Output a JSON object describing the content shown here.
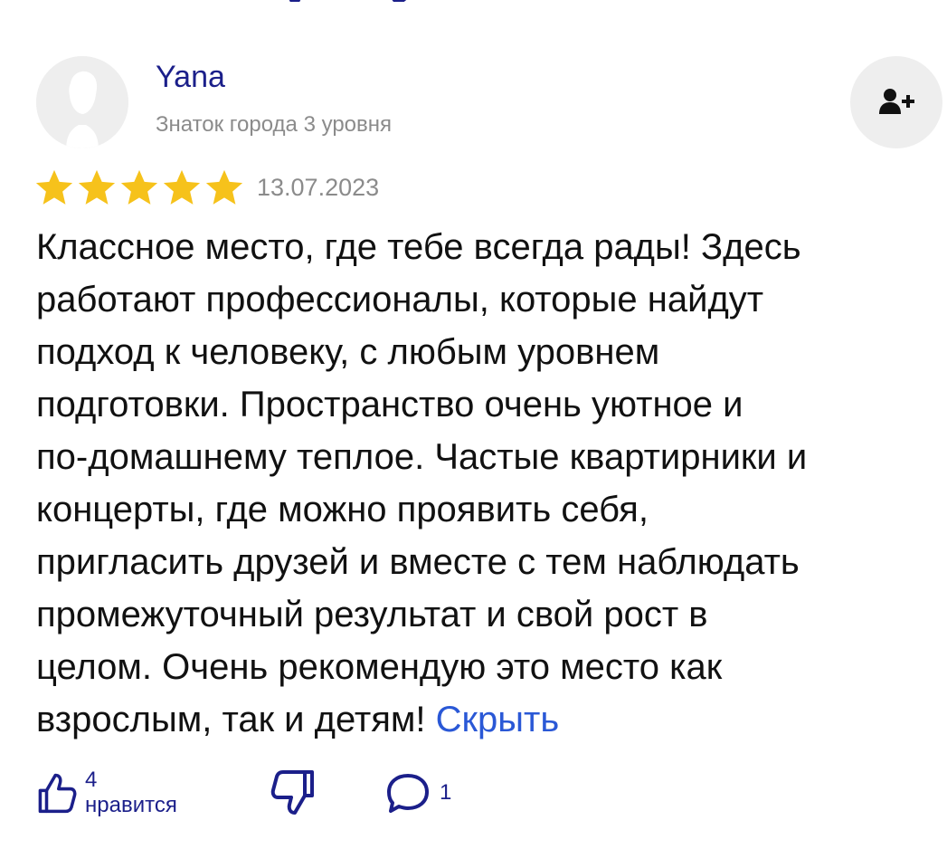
{
  "review": {
    "author": {
      "name": "Yana",
      "level": "Знаток города 3 уровня"
    },
    "rating": 5,
    "date": "13.07.2023",
    "text_lines": [
      "Классное место, где тебе всегда рады! Здесь",
      "работают профессионалы, которые найдут",
      "подход к человеку, с любым уровнем",
      "подготовки. Пространство очень уютное и",
      "по-домашнему теплое. Частые квартирники и",
      "концерты, где можно проявить себя,",
      "пригласить друзей и вместе с тем наблюдать",
      "промежуточный результат и свой рост в",
      "целом. Очень рекомендую это место как",
      "взрослым, так и детям!"
    ],
    "hide_link": "Скрыть",
    "likes_label": "4 нравится",
    "comments_count": "1"
  },
  "icons": {
    "subscribe": "add-user-icon",
    "like": "thumbs-up-icon",
    "dislike": "thumbs-down-icon",
    "comment": "comment-icon",
    "star": "star-icon"
  },
  "colors": {
    "accent": "#1b1f8a",
    "link": "#2a58d6",
    "star": "#f6c21b",
    "muted": "#8b8b8b",
    "avatar_bg": "#eeeeee"
  }
}
